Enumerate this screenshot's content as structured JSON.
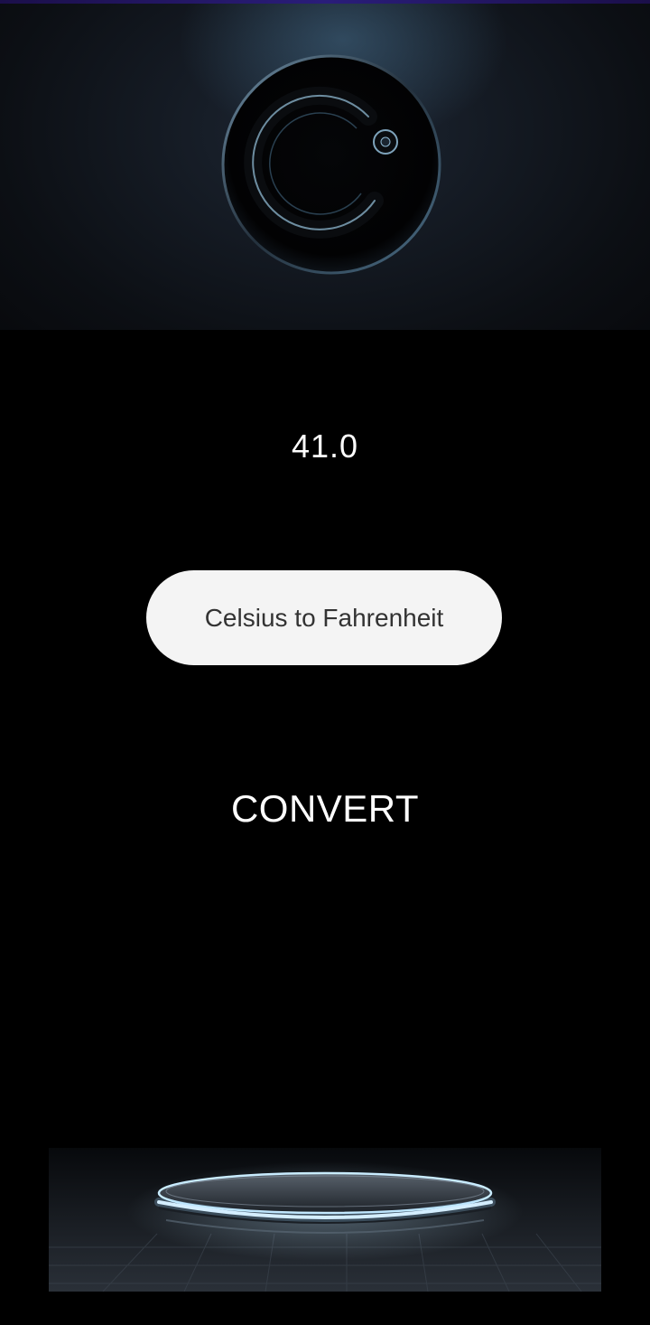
{
  "header": {
    "logo_icon": "celsius-c-logo-icon"
  },
  "display": {
    "value": "41.0"
  },
  "mode_selector": {
    "label": "Celsius to Fahrenheit"
  },
  "actions": {
    "convert_label": "CONVERT"
  },
  "footer": {
    "image_icon": "glowing-podium-icon"
  },
  "colors": {
    "background": "#000000",
    "pill_background": "#f4f4f4",
    "pill_text": "#333333",
    "text_primary": "#ffffff",
    "glow_accent": "#9fd8ff"
  }
}
